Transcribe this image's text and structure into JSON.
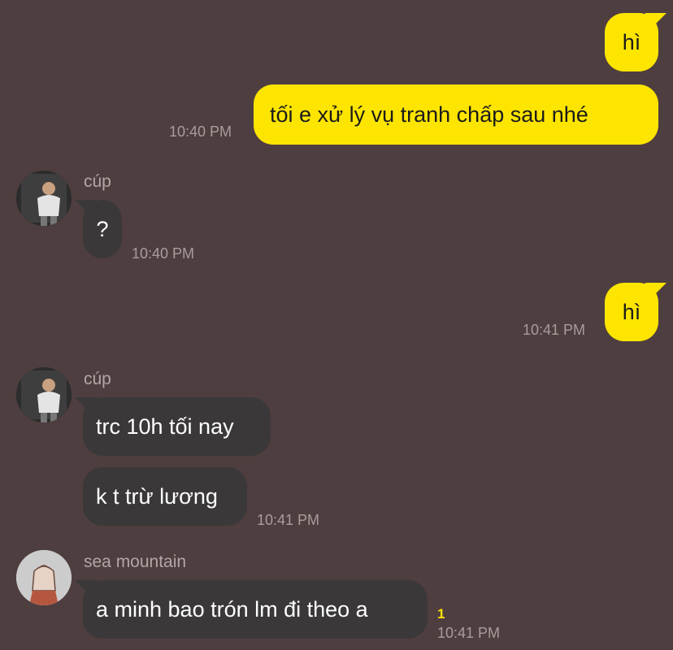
{
  "messages": [
    {
      "text": "hì"
    },
    {
      "text": "tối e xử lý vụ tranh chấp sau nhé",
      "time": "10:40 PM"
    },
    {
      "sender": "cúp",
      "text": "?",
      "time": "10:40 PM"
    },
    {
      "text": "hì",
      "time": "10:41 PM"
    },
    {
      "sender": "cúp",
      "text": "trc 10h tối nay"
    },
    {
      "text": "k t trừ lương",
      "time": "10:41 PM"
    },
    {
      "sender": "sea mountain",
      "text": "a minh bao trón lm đi theo a",
      "time": "10:41 PM",
      "unread": "1"
    }
  ],
  "colors": {
    "background": "#4f3e3f",
    "sent_bubble": "#fee500",
    "received_bubble": "#3b3839",
    "timestamp": "#a89c9d"
  }
}
